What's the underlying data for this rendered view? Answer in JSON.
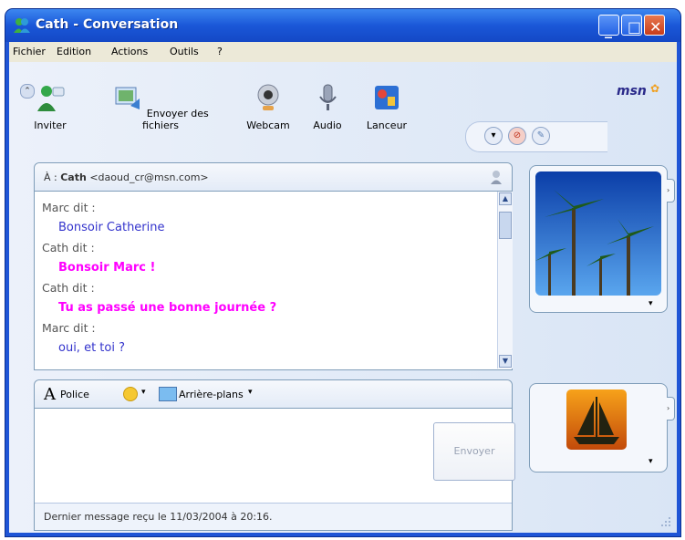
{
  "window": {
    "title": "Cath - Conversation",
    "title_bar_color": "#1a57d8",
    "controls": {
      "minimize": "_",
      "maximize": "□",
      "close": "✕"
    }
  },
  "menu": [
    "Fichier",
    "Edition",
    "Actions",
    "Outils",
    "?"
  ],
  "toolbar": {
    "items": [
      {
        "label": "Inviter",
        "icon": "invite-contact-icon"
      },
      {
        "label": "Envoyer des fichiers",
        "icon": "send-files-icon"
      },
      {
        "label": "Webcam",
        "icon": "webcam-icon"
      },
      {
        "label": "Audio",
        "icon": "microphone-icon"
      },
      {
        "label": "Lanceur",
        "icon": "activities-launcher-icon"
      }
    ],
    "brand": "msn"
  },
  "to": {
    "prefix": "À :",
    "name": "Cath",
    "email": "<daoud_cr@msn.com>"
  },
  "conversation": [
    {
      "text": "Marc dit :",
      "kind": "speaker"
    },
    {
      "text": "Bonsoir Catherine",
      "kind": "marc"
    },
    {
      "text": "Cath dit :",
      "kind": "speaker"
    },
    {
      "text": "Bonsoir Marc !",
      "kind": "cath"
    },
    {
      "text": "Cath dit :",
      "kind": "speaker"
    },
    {
      "text": "Tu as passé une bonne journée ?",
      "kind": "cath"
    },
    {
      "text": "Marc dit :",
      "kind": "speaker"
    },
    {
      "text": "oui, et toi ?",
      "kind": "marc"
    }
  ],
  "colors": {
    "marc": "#3333cc",
    "cath": "#ff00ff",
    "speaker": "#555555"
  },
  "compose": {
    "font_label": "Police",
    "background_label": "Arrière-plans",
    "send_label": "Envoyer"
  },
  "status": "Dernier message reçu le 11/03/2004 à 20:16."
}
